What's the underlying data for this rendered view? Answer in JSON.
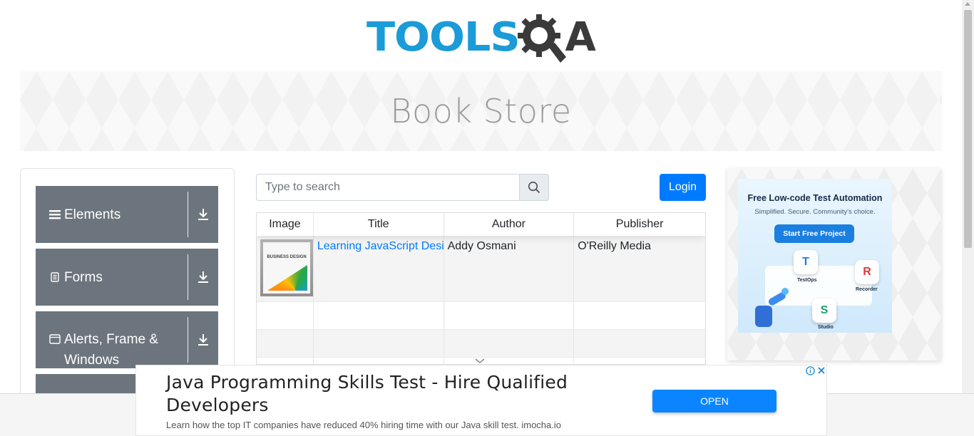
{
  "header": {
    "logo_tools": "TOOLS",
    "logo_qa": "QA"
  },
  "banner": {
    "title": "Book Store"
  },
  "sidenav": {
    "groups": [
      {
        "label": "Elements",
        "icon": "hamburger-icon"
      },
      {
        "label": "Forms",
        "icon": "document-icon"
      },
      {
        "label": "Alerts, Frame & Windows",
        "icon": "window-icon"
      }
    ]
  },
  "search": {
    "placeholder": "Type to search",
    "value": ""
  },
  "login": {
    "label": "Login"
  },
  "table": {
    "headers": [
      "Image",
      "Title",
      "Author",
      "Publisher"
    ],
    "rows": [
      {
        "title": "Learning JavaScript Design Patterns",
        "author": "Addy Osmani",
        "publisher": "O'Reilly Media",
        "cover_text": "BUSINESS DESIGN"
      }
    ]
  },
  "ad_right": {
    "headline": "Free Low-code Test Automation",
    "sub": "Simplified. Secure. Community's choice.",
    "cta": "Start Free Project",
    "tiles": [
      "TestOps",
      "Recorder",
      "Studio"
    ]
  },
  "bottom_ad": {
    "title": "Java Programming Skills Test - Hire Qualified Developers",
    "sub": "Learn how the top IT companies have reduced 40% hiring time with our Java skill test. imocha.io",
    "cta": "OPEN"
  },
  "colors": {
    "brand_blue": "#1b9bd7",
    "primary": "#007bff",
    "nav_gray": "#6c757d"
  }
}
